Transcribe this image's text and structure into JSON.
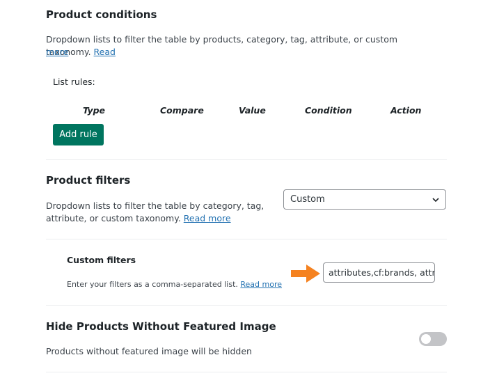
{
  "product_conditions": {
    "title": "Product conditions",
    "description": "Dropdown lists to filter the table by products, category, tag, attribute, or custom taxonomy.",
    "read_more": "Read",
    "read_more_wrap": "more",
    "list_rules_label": "List rules:",
    "columns": [
      "Type",
      "Compare",
      "Value",
      "Condition",
      "Action"
    ],
    "add_rule_label": "Add rule"
  },
  "product_filters": {
    "title": "Product filters",
    "description_line1": "Dropdown lists to filter the table by category, tag,",
    "description_line2": "attribute, or custom taxonomy.",
    "read_more": "Read more",
    "select_value": "Custom"
  },
  "custom_filters": {
    "title": "Custom filters",
    "description": "Enter your filters as a comma-separated list.",
    "read_more": "Read more",
    "input_value": "attributes,cf:brands, attr"
  },
  "hide_products": {
    "title": "Hide Products Without Featured Image",
    "description": "Products without featured image will be hidden",
    "enabled": false
  },
  "colors": {
    "accent": "#00755f",
    "link": "#2271b1",
    "arrow": "#f58220",
    "toggle_off": "#c3c4c7"
  },
  "icons": {
    "select_caret": "chevron-down-icon",
    "pointer": "arrow-right-icon"
  }
}
